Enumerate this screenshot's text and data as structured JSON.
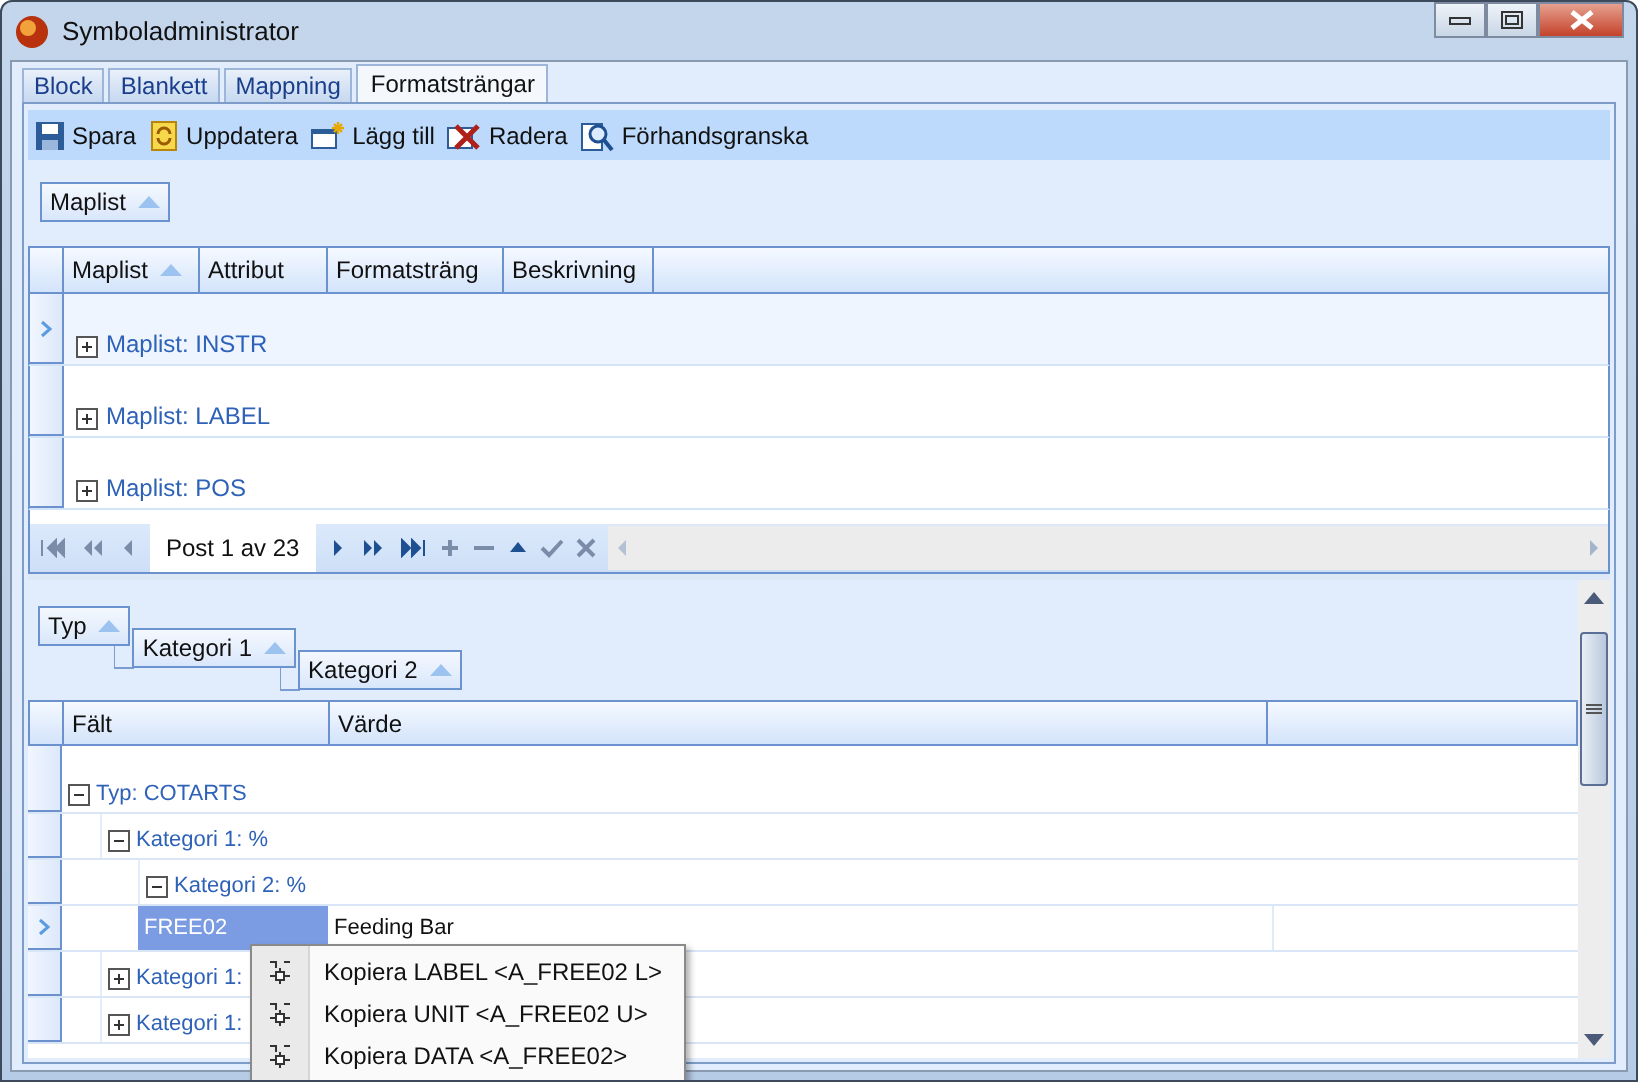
{
  "window": {
    "title": "Symboladministrator"
  },
  "tabs": [
    {
      "label": "Block",
      "selected": false
    },
    {
      "label": "Blankett",
      "selected": false
    },
    {
      "label": "Mappning",
      "selected": false
    },
    {
      "label": "Formatsträngar",
      "selected": true
    }
  ],
  "toolbar": [
    {
      "label": "Spara"
    },
    {
      "label": "Uppdatera"
    },
    {
      "label": "Lägg till"
    },
    {
      "label": "Radera"
    },
    {
      "label": "Förhandsgranska"
    }
  ],
  "top_grid": {
    "group_panel": [
      {
        "label": "Maplist",
        "sorted": true
      }
    ],
    "columns": [
      {
        "label": "Maplist",
        "sorted": true
      },
      {
        "label": "Attribut"
      },
      {
        "label": "Formatsträng"
      },
      {
        "label": "Beskrivning"
      }
    ],
    "rows": [
      {
        "label": "Maplist: INSTR",
        "expanded": false,
        "selected": true
      },
      {
        "label": "Maplist: LABEL",
        "expanded": false,
        "selected": false
      },
      {
        "label": "Maplist: POS",
        "expanded": false,
        "selected": false
      }
    ],
    "navigator": {
      "text": "Post 1 av 23"
    }
  },
  "bottom_grid": {
    "group_panel": [
      {
        "label": "Typ",
        "sorted": true
      },
      {
        "label": "Kategori 1",
        "sorted": true
      },
      {
        "label": "Kategori 2",
        "sorted": true
      }
    ],
    "columns": [
      {
        "label": "Fält"
      },
      {
        "label": "Värde"
      }
    ],
    "rows": [
      {
        "kind": "group",
        "label": "Typ: COTARTS",
        "expanded": true,
        "children": [
          {
            "kind": "group",
            "label": "Kategori 1: %",
            "expanded": true,
            "children": [
              {
                "kind": "group",
                "label": "Kategori 2: %",
                "expanded": true,
                "children": [
                  {
                    "kind": "data",
                    "field": "FREE02",
                    "value": "Feeding Bar",
                    "selected": true
                  }
                ]
              }
            ]
          },
          {
            "kind": "group",
            "label": "Kategori 1:",
            "expanded": false
          },
          {
            "kind": "group",
            "label": "Kategori 1:",
            "expanded": false
          }
        ]
      }
    ]
  },
  "context_menu": [
    {
      "label": "Kopiera LABEL <A_FREE02 L>"
    },
    {
      "label": "Kopiera UNIT <A_FREE02 U>"
    },
    {
      "label": "Kopiera DATA <A_FREE02>"
    }
  ]
}
